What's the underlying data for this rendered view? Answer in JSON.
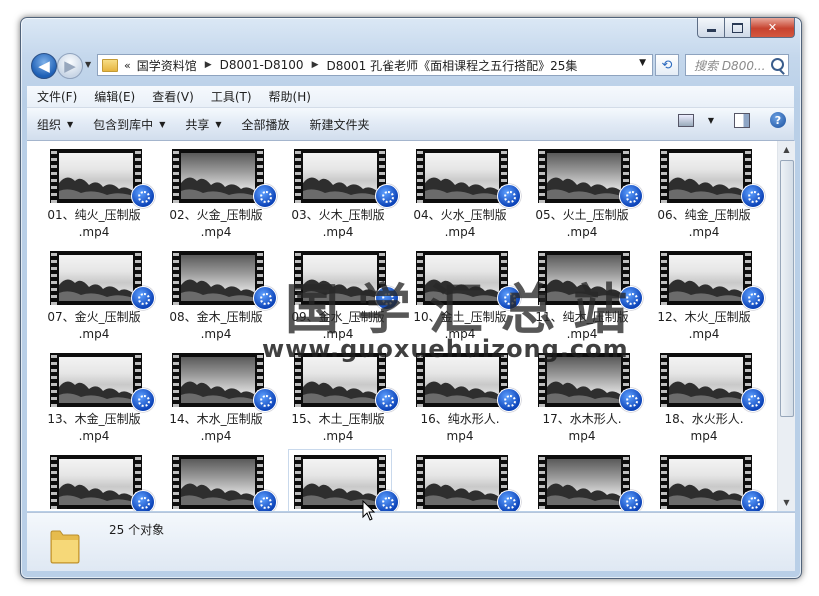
{
  "window": {
    "caption": {
      "minimize": "",
      "maximize": "",
      "close": "✕"
    }
  },
  "nav": {
    "back_glyph": "◀",
    "forward_glyph": "▶",
    "history_glyph": "▼",
    "breadcrumb_lead": "«",
    "breadcrumbs": [
      "国学资料馆",
      "D8001-D8100",
      "D8001 孔雀老师《面相课程之五行搭配》25集"
    ],
    "separator": "▶",
    "address_dropdown": "▼",
    "refresh_glyph": "⟲",
    "search_placeholder": "搜索 D800..."
  },
  "menu": [
    "文件(F)",
    "编辑(E)",
    "查看(V)",
    "工具(T)",
    "帮助(H)"
  ],
  "toolbar": {
    "organize": "组织",
    "include_in_library": "包含到库中",
    "share": "共享",
    "play_all": "全部播放",
    "new_folder": "新建文件夹",
    "dropdown_glyph": "▼",
    "help_glyph": "?"
  },
  "files": [
    {
      "line1": "01、纯火_压制版",
      "line2": ".mp4"
    },
    {
      "line1": "02、火金_压制版",
      "line2": ".mp4"
    },
    {
      "line1": "03、火木_压制版",
      "line2": ".mp4"
    },
    {
      "line1": "04、火水_压制版",
      "line2": ".mp4"
    },
    {
      "line1": "05、火土_压制版",
      "line2": ".mp4"
    },
    {
      "line1": "06、纯金_压制版",
      "line2": ".mp4"
    },
    {
      "line1": "07、金火_压制版",
      "line2": ".mp4"
    },
    {
      "line1": "08、金木_压制版",
      "line2": ".mp4"
    },
    {
      "line1": "09、金水_压制版",
      "line2": ".mp4"
    },
    {
      "line1": "10、金土_压制版",
      "line2": ".mp4"
    },
    {
      "line1": "11、纯木_压制版",
      "line2": ".mp4"
    },
    {
      "line1": "12、木火_压制版",
      "line2": ".mp4"
    },
    {
      "line1": "13、木金_压制版",
      "line2": ".mp4"
    },
    {
      "line1": "14、木水_压制版",
      "line2": ".mp4"
    },
    {
      "line1": "15、木土_压制版",
      "line2": ".mp4"
    },
    {
      "line1": "16、纯水形人.",
      "line2": "mp4"
    },
    {
      "line1": "17、水木形人.",
      "line2": "mp4"
    },
    {
      "line1": "18、水火形人.",
      "line2": "mp4"
    },
    {
      "line1": "",
      "line2": ""
    },
    {
      "line1": "",
      "line2": ""
    },
    {
      "line1": "",
      "line2": ""
    },
    {
      "line1": "",
      "line2": ""
    },
    {
      "line1": "",
      "line2": ""
    },
    {
      "line1": "",
      "line2": ""
    }
  ],
  "scroll": {
    "up_glyph": "▲",
    "down_glyph": "▼"
  },
  "watermark": {
    "title": "国学汇总站",
    "url": "www.guoxuehuizong.com"
  },
  "status": {
    "count_text": "25 个对象"
  }
}
